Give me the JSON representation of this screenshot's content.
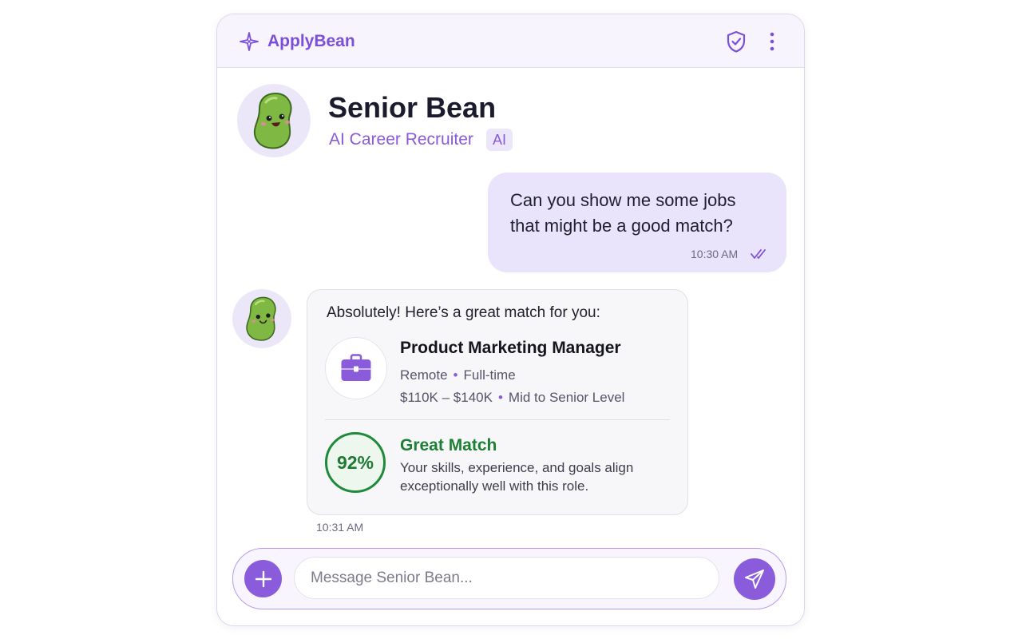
{
  "header": {
    "brand_name": "ApplyBean",
    "brand_icon": "sparkle-icon",
    "shield_icon": "shield-check-icon",
    "menu_icon": "more-vertical-icon"
  },
  "profile": {
    "name": "Senior Bean",
    "role": "AI Career Recruiter",
    "badge": "AI",
    "avatar_icon": "bean-mascot-icon"
  },
  "messages": [
    {
      "sender": "user",
      "text": "Can you show me some jobs that might be a good match?",
      "time": "10:30 AM",
      "status_icon": "double-check-icon"
    },
    {
      "sender": "bot",
      "intro": "Absolutely! Here’s a great match for you:",
      "job": {
        "icon": "briefcase-icon",
        "title": "Product Marketing Manager",
        "location": "Remote",
        "employment_type": "Full-time",
        "salary": "$110K – $140K",
        "level": "Mid to Senior Level"
      },
      "match": {
        "percent_label": "92%",
        "percent": 92,
        "title": "Great Match",
        "description": "Your skills, experience, and goals align exceptionally well with this role."
      },
      "time": "10:31 AM"
    }
  ],
  "composer": {
    "placeholder": "Message Senior Bean...",
    "value": "",
    "attach_icon": "plus-icon",
    "send_icon": "send-icon"
  },
  "colors": {
    "accent": "#8a5cdb",
    "user_bubble": "#e9e3fb",
    "match_green": "#1f8a3a"
  }
}
